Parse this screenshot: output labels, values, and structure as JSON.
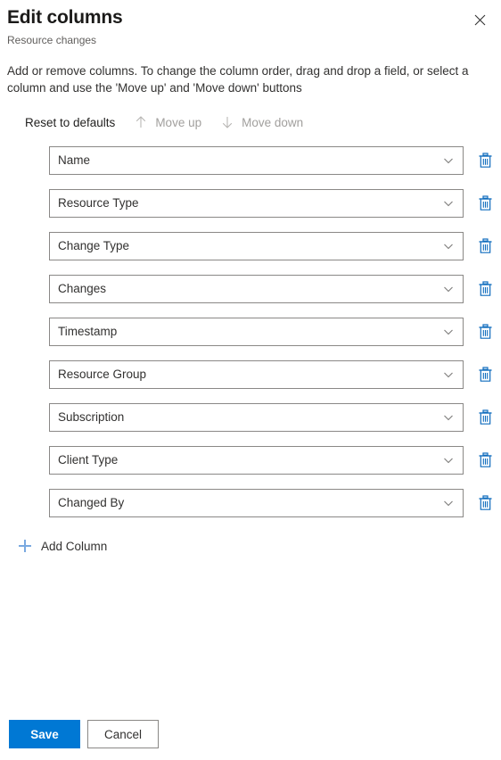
{
  "panel": {
    "title": "Edit columns",
    "subtitle": "Resource changes",
    "description": "Add or remove columns. To change the column order, drag and drop a field, or select a column and use the 'Move up' and 'Move down' buttons",
    "close_icon": "close-icon"
  },
  "command_bar": {
    "reset": {
      "label": "Reset to defaults",
      "enabled": true
    },
    "move_up": {
      "label": "Move up",
      "enabled": false,
      "icon": "arrow-up-icon"
    },
    "move_down": {
      "label": "Move down",
      "enabled": false,
      "icon": "arrow-down-icon"
    }
  },
  "columns": [
    {
      "label": "Name",
      "chevron": "chevron-down-icon",
      "delete": "trash-icon"
    },
    {
      "label": "Resource Type",
      "chevron": "chevron-down-icon",
      "delete": "trash-icon"
    },
    {
      "label": "Change Type",
      "chevron": "chevron-down-icon",
      "delete": "trash-icon"
    },
    {
      "label": "Changes",
      "chevron": "chevron-down-icon",
      "delete": "trash-icon"
    },
    {
      "label": "Timestamp",
      "chevron": "chevron-down-icon",
      "delete": "trash-icon"
    },
    {
      "label": "Resource Group",
      "chevron": "chevron-down-icon",
      "delete": "trash-icon"
    },
    {
      "label": "Subscription",
      "chevron": "chevron-down-icon",
      "delete": "trash-icon"
    },
    {
      "label": "Client Type",
      "chevron": "chevron-down-icon",
      "delete": "trash-icon"
    },
    {
      "label": "Changed By",
      "chevron": "chevron-down-icon",
      "delete": "trash-icon"
    }
  ],
  "add_column": {
    "label": "Add Column",
    "icon": "plus-icon"
  },
  "footer": {
    "save_label": "Save",
    "cancel_label": "Cancel"
  },
  "colors": {
    "accent": "#0078d4",
    "text": "#323130",
    "text_secondary": "#605e5c",
    "disabled": "#a19f9d",
    "border": "#8a8886"
  }
}
